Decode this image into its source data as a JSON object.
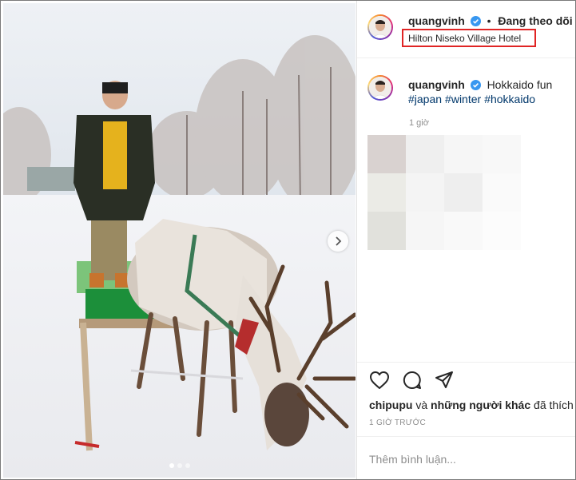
{
  "post": {
    "username": "quangvinh",
    "follow_separator": "•",
    "follow_status": "Đang theo dõi",
    "location": "Hilton Niseko Village Hotel",
    "carousel_total": 3,
    "carousel_active": 1
  },
  "caption": {
    "username": "quangvinh",
    "text": "Hokkaido fun",
    "hashtags": [
      "#japan",
      "#winter",
      "#hokkaido"
    ],
    "time": "1 giờ"
  },
  "engagement": {
    "liked_by": "chipupu",
    "and_text": "và",
    "others_text": "những người khác",
    "liked_text": "đã thích",
    "timestamp": "1 GIỜ TRƯỚC"
  },
  "comment_box": {
    "placeholder": "Thêm bình luận..."
  },
  "icons": {
    "like": "heart-icon",
    "comment": "comment-icon",
    "share": "send-icon",
    "verified": "verified-badge-icon",
    "next": "chevron-right-icon"
  },
  "colors": {
    "verified": "#3897f0",
    "hashtag": "#00376b",
    "highlight_box": "#e02424",
    "muted": "#8e8e8e"
  }
}
